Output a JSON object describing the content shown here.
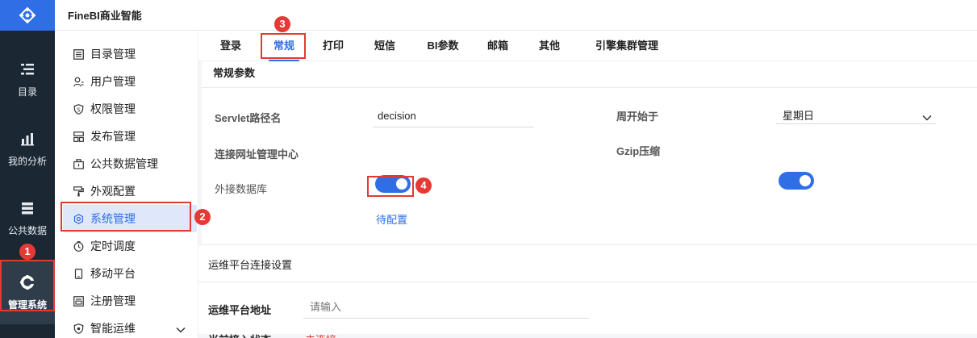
{
  "app": {
    "title": "FineBI商业智能"
  },
  "rail": {
    "items": [
      {
        "label": "目录",
        "icon": "catalog-icon"
      },
      {
        "label": "我的分析",
        "icon": "analysis-icon"
      },
      {
        "label": "公共数据",
        "icon": "public-data-icon"
      },
      {
        "label": "管理系统",
        "icon": "gear-icon"
      }
    ]
  },
  "sidebar": {
    "items": [
      {
        "label": "目录管理"
      },
      {
        "label": "用户管理"
      },
      {
        "label": "权限管理"
      },
      {
        "label": "发布管理"
      },
      {
        "label": "公共数据管理"
      },
      {
        "label": "外观配置"
      },
      {
        "label": "系统管理"
      },
      {
        "label": "定时调度"
      },
      {
        "label": "移动平台"
      },
      {
        "label": "注册管理"
      },
      {
        "label": "智能运维"
      }
    ]
  },
  "tabs": [
    "登录",
    "常规",
    "打印",
    "短信",
    "BI参数",
    "邮箱",
    "其他",
    "引擎集群管理"
  ],
  "general": {
    "title": "常规参数",
    "servlet_label": "Servlet路径名",
    "servlet_value": "decision",
    "week_start_label": "周开始于",
    "week_start_value": "星期日",
    "url_center_label": "连接网址管理中心",
    "gzip_label": "Gzip压缩",
    "ext_db_label": "外接数据库",
    "ext_db_action": "待配置"
  },
  "ops": {
    "title": "运维平台连接设置",
    "address_label": "运维平台地址",
    "address_placeholder": "请输入",
    "status_label": "当前接入状态",
    "status_value": "未连接"
  },
  "annotations": [
    "1",
    "2",
    "3",
    "4"
  ],
  "colors": {
    "accent": "#2f6ee5",
    "rail_bg": "#1b2733",
    "marker": "#e53935"
  }
}
